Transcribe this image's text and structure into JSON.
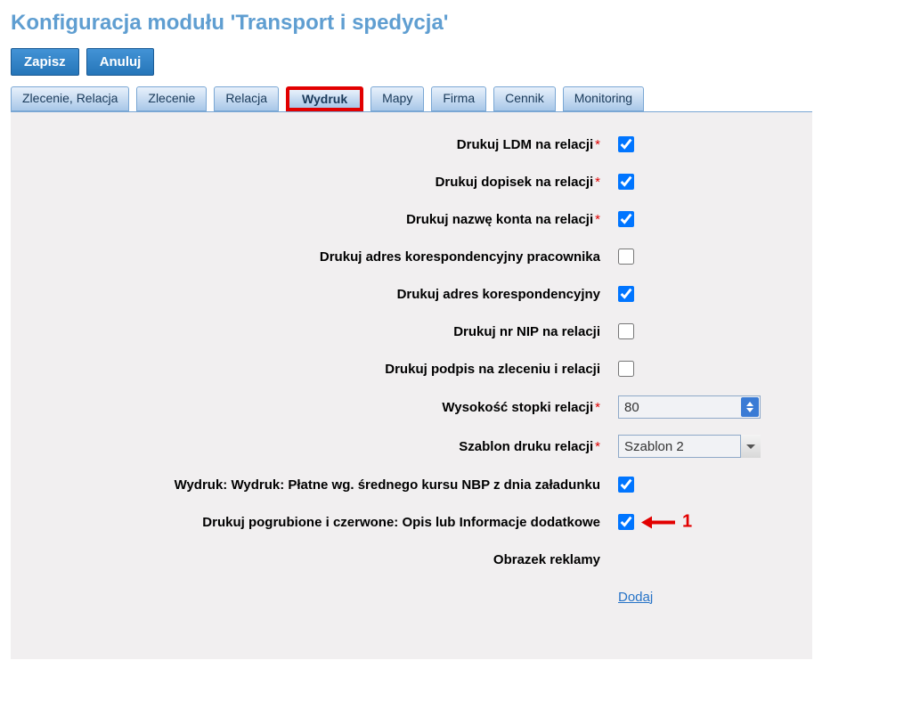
{
  "header": {
    "title": "Konfiguracja modułu 'Transport i spedycja'"
  },
  "buttons": {
    "save": "Zapisz",
    "cancel": "Anuluj"
  },
  "tabs": [
    {
      "label": "Zlecenie, Relacja"
    },
    {
      "label": "Zlecenie"
    },
    {
      "label": "Relacja"
    },
    {
      "label": "Wydruk",
      "active": true
    },
    {
      "label": "Mapy"
    },
    {
      "label": "Firma"
    },
    {
      "label": "Cennik"
    },
    {
      "label": "Monitoring"
    }
  ],
  "form": {
    "rows": [
      {
        "label": "Drukuj LDM na relacji",
        "required": true,
        "type": "checkbox",
        "checked": true
      },
      {
        "label": "Drukuj dopisek na relacji",
        "required": true,
        "type": "checkbox",
        "checked": true
      },
      {
        "label": "Drukuj nazwę konta na relacji",
        "required": true,
        "type": "checkbox",
        "checked": true
      },
      {
        "label": "Drukuj adres korespondencyjny pracownika",
        "required": false,
        "type": "checkbox",
        "checked": false
      },
      {
        "label": "Drukuj adres korespondencyjny",
        "required": false,
        "type": "checkbox",
        "checked": true
      },
      {
        "label": "Drukuj nr NIP na relacji",
        "required": false,
        "type": "checkbox",
        "checked": false
      },
      {
        "label": "Drukuj podpis na zleceniu i relacji",
        "required": false,
        "type": "checkbox",
        "checked": false
      },
      {
        "label": "Wysokość stopki relacji",
        "required": true,
        "type": "number",
        "value": "80"
      },
      {
        "label": "Szablon druku relacji",
        "required": true,
        "type": "select",
        "value": "Szablon 2"
      },
      {
        "label": "Wydruk: Wydruk: Płatne wg. średnego kursu NBP z dnia załadunku",
        "required": false,
        "type": "checkbox",
        "checked": true
      },
      {
        "label": "Drukuj pogrubione i czerwone: Opis lub Informacje dodatkowe",
        "required": false,
        "type": "checkbox",
        "checked": true,
        "annotation": "1"
      },
      {
        "label": "Obrazek reklamy",
        "required": false,
        "type": "none"
      }
    ],
    "add_link": "Dodaj"
  }
}
